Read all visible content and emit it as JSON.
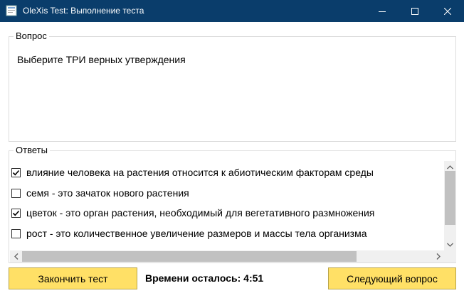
{
  "window": {
    "title": "OleXis Test: Выполнение теста",
    "icon": "app-icon",
    "controls": [
      "minimize-icon",
      "maximize-icon",
      "close-icon"
    ]
  },
  "question": {
    "legend": "Вопрос",
    "text": "Выберите ТРИ верных утверждения"
  },
  "answers": {
    "legend": "Ответы",
    "items": [
      {
        "label": "влияние человека на растения относится к абиотическим факторам среды",
        "checked": true
      },
      {
        "label": "семя - это зачаток нового растения",
        "checked": false
      },
      {
        "label": "цветок - это орган растения, необходимый для вегетативного размножения",
        "checked": true
      },
      {
        "label": "рост - это количественное увеличение размеров и массы тела организма",
        "checked": false
      }
    ]
  },
  "footer": {
    "finish_label": "Закончить тест",
    "timer_text": "Времени осталось: 4:51",
    "next_label": "Следующий вопрос"
  },
  "colors": {
    "titlebar": "#0a3d6b",
    "button": "#ffe066",
    "scrollbar_track": "#f0f0f0",
    "scrollbar_thumb": "#c1c1c1"
  }
}
